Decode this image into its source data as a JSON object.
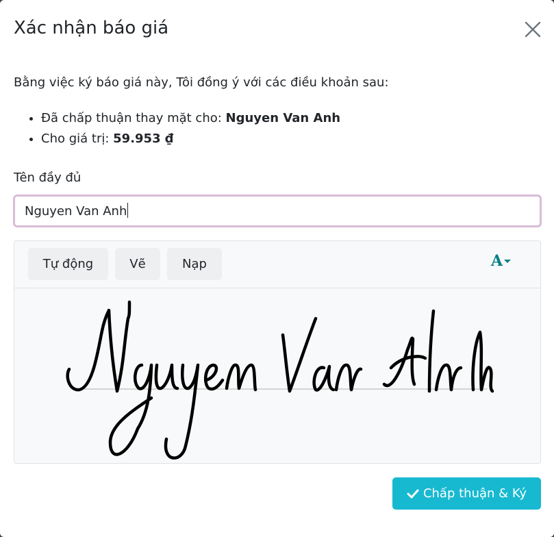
{
  "dialog": {
    "title": "Xác nhận báo giá",
    "intro": "Bằng việc ký báo giá này, Tôi đồng ý với các điều khoản sau:",
    "terms": [
      {
        "label": "Đã chấp thuận thay mặt cho: ",
        "value": "Nguyen Van Anh"
      },
      {
        "label": "Cho giá trị: ",
        "value": "59.953 ₫"
      }
    ],
    "fullname_label": "Tên đầy đủ",
    "fullname_value": "Nguyen Van Anh",
    "signature": {
      "tabs": [
        "Tự động",
        "Vẽ",
        "Nạp"
      ],
      "font_button_glyph": "A",
      "signed_text": "Nguyen Van Anh"
    },
    "submit_label": "Chấp thuận & Ký"
  },
  "colors": {
    "accent": "#17b9d0",
    "font_icon": "#017e84",
    "input_focus_border": "#d9bcd6"
  },
  "icons": [
    "close-icon",
    "font-select-icon",
    "check-icon"
  ]
}
